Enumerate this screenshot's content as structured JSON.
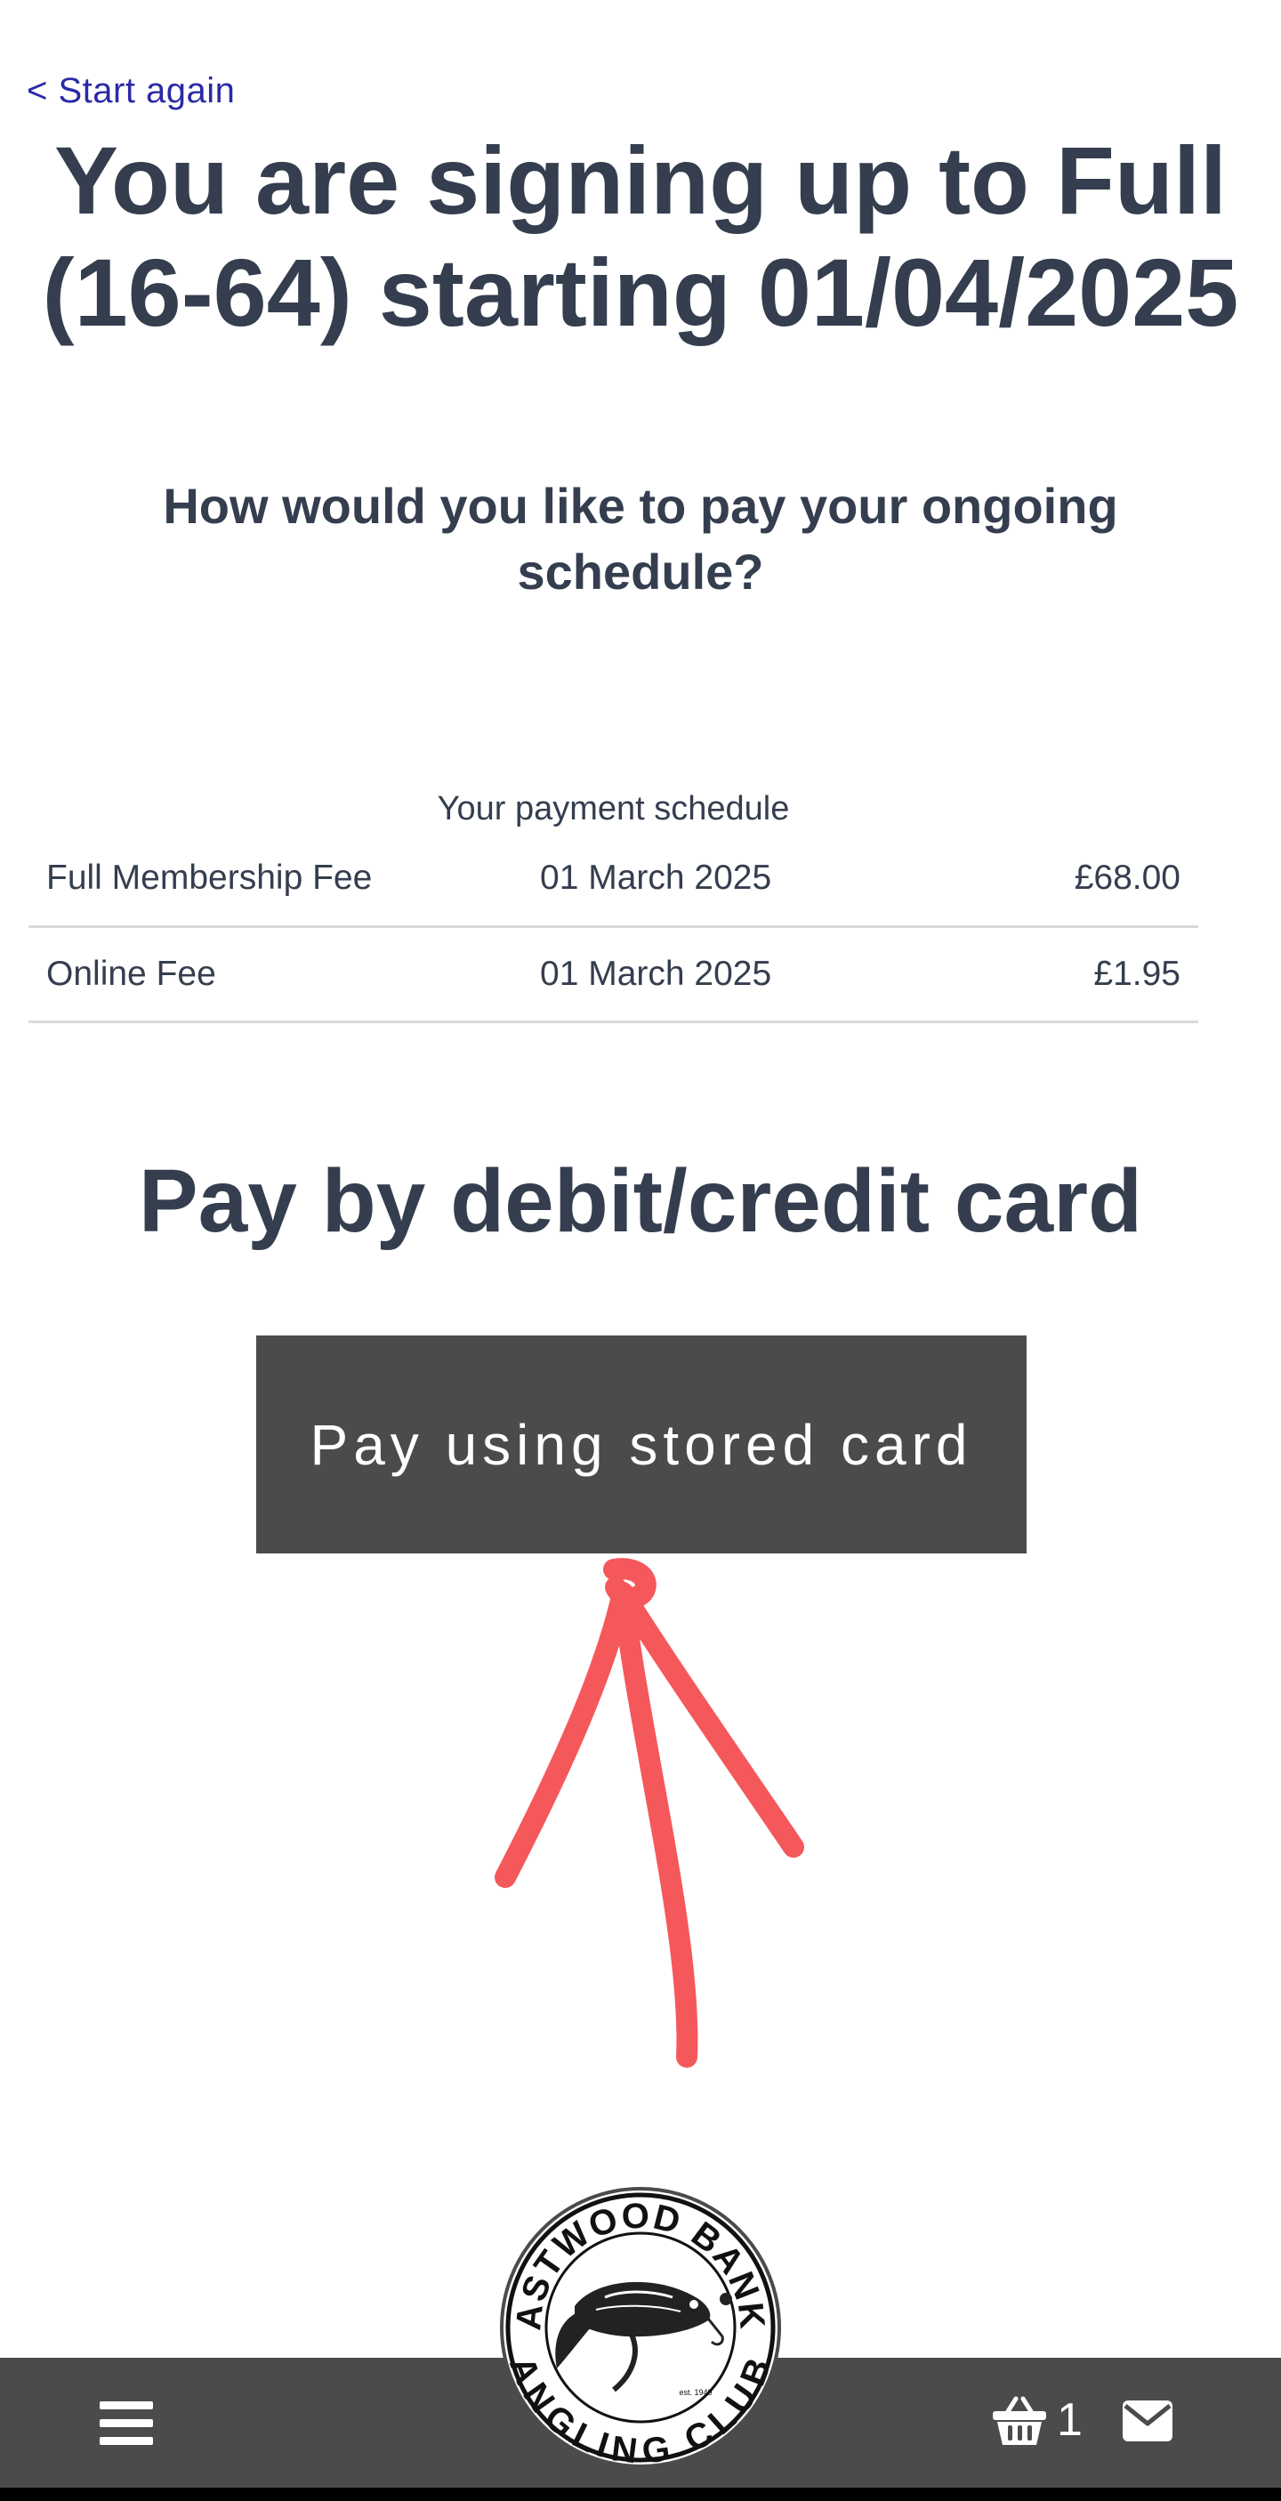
{
  "nav": {
    "back_label": "< Start again"
  },
  "header": {
    "title": "You are signing up to Full (16-64) starting 01/04/2025"
  },
  "question": "How would you like to pay your ongoing schedule?",
  "schedule": {
    "caption": "Your payment schedule",
    "rows": [
      {
        "description": "Full Membership Fee",
        "date": "01 March 2025",
        "amount": "£68.00"
      },
      {
        "description": "Online Fee",
        "date": "01 March 2025",
        "amount": "£1.95"
      }
    ]
  },
  "payment": {
    "heading": "Pay by debit/credit card",
    "button_label": "Pay using stored card"
  },
  "footer": {
    "basket_count": "1",
    "logo_text_top": "ASTWOOD BANK",
    "logo_text_bottom": "ANGLING CLUB",
    "logo_est": "est. 1949",
    "icons": [
      "menu-icon",
      "basket-icon",
      "mail-icon"
    ]
  },
  "colors": {
    "text": "#353e4f",
    "link": "#2a2aa6",
    "button_bg": "#4b4b4b",
    "footer_bg": "#4b4b4b",
    "annotation": "#f5585b"
  }
}
